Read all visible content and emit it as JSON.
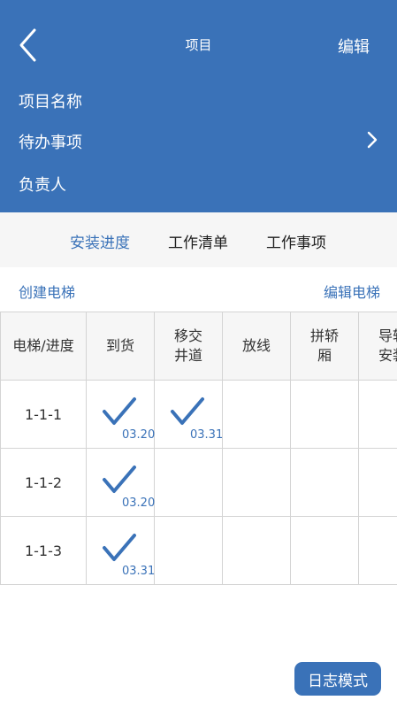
{
  "header": {
    "title": "项目",
    "edit_label": "编辑",
    "rows": [
      {
        "label": "项目名称"
      },
      {
        "label": "待办事项"
      },
      {
        "label": "负责人"
      }
    ],
    "bg_color": "#3a72b8",
    "back_icon": "chevron-left-icon",
    "row_chevron_icon": "chevron-right-icon"
  },
  "tabs": [
    {
      "label": "安装进度",
      "active": true
    },
    {
      "label": "工作清单",
      "active": false
    },
    {
      "label": "工作事项",
      "active": false
    }
  ],
  "actions": {
    "create_label": "创建电梯",
    "edit_label": "编辑电梯"
  },
  "table": {
    "headers": [
      "电梯/进度",
      "到货",
      "移交\n井道",
      "放线",
      "拼轿\n厢",
      "导轨\n安装"
    ],
    "rows": [
      {
        "label": "1-1-1",
        "cells": [
          {
            "checked": true,
            "date": "03.20"
          },
          {
            "checked": true,
            "date": "03.31"
          },
          {
            "checked": false
          },
          {
            "checked": false
          },
          {
            "checked": false
          }
        ]
      },
      {
        "label": "1-1-2",
        "cells": [
          {
            "checked": true,
            "date": "03.20"
          },
          {
            "checked": false
          },
          {
            "checked": false
          },
          {
            "checked": false
          },
          {
            "checked": false
          }
        ]
      },
      {
        "label": "1-1-3",
        "cells": [
          {
            "checked": true,
            "date": "03.31"
          },
          {
            "checked": false
          },
          {
            "checked": false
          },
          {
            "checked": false
          },
          {
            "checked": false
          }
        ]
      }
    ],
    "check_icon": "checkmark-icon",
    "accent_color": "#3a72b8"
  },
  "log_button_label": "日志模式"
}
